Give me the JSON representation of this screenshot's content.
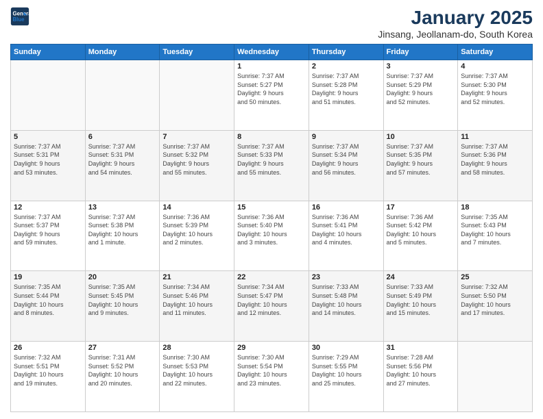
{
  "header": {
    "logo_line1": "General",
    "logo_line2": "Blue",
    "title": "January 2025",
    "subtitle": "Jinsang, Jeollanam-do, South Korea"
  },
  "weekdays": [
    "Sunday",
    "Monday",
    "Tuesday",
    "Wednesday",
    "Thursday",
    "Friday",
    "Saturday"
  ],
  "weeks": [
    [
      {
        "day": "",
        "info": ""
      },
      {
        "day": "",
        "info": ""
      },
      {
        "day": "",
        "info": ""
      },
      {
        "day": "1",
        "info": "Sunrise: 7:37 AM\nSunset: 5:27 PM\nDaylight: 9 hours\nand 50 minutes."
      },
      {
        "day": "2",
        "info": "Sunrise: 7:37 AM\nSunset: 5:28 PM\nDaylight: 9 hours\nand 51 minutes."
      },
      {
        "day": "3",
        "info": "Sunrise: 7:37 AM\nSunset: 5:29 PM\nDaylight: 9 hours\nand 52 minutes."
      },
      {
        "day": "4",
        "info": "Sunrise: 7:37 AM\nSunset: 5:30 PM\nDaylight: 9 hours\nand 52 minutes."
      }
    ],
    [
      {
        "day": "5",
        "info": "Sunrise: 7:37 AM\nSunset: 5:31 PM\nDaylight: 9 hours\nand 53 minutes."
      },
      {
        "day": "6",
        "info": "Sunrise: 7:37 AM\nSunset: 5:31 PM\nDaylight: 9 hours\nand 54 minutes."
      },
      {
        "day": "7",
        "info": "Sunrise: 7:37 AM\nSunset: 5:32 PM\nDaylight: 9 hours\nand 55 minutes."
      },
      {
        "day": "8",
        "info": "Sunrise: 7:37 AM\nSunset: 5:33 PM\nDaylight: 9 hours\nand 55 minutes."
      },
      {
        "day": "9",
        "info": "Sunrise: 7:37 AM\nSunset: 5:34 PM\nDaylight: 9 hours\nand 56 minutes."
      },
      {
        "day": "10",
        "info": "Sunrise: 7:37 AM\nSunset: 5:35 PM\nDaylight: 9 hours\nand 57 minutes."
      },
      {
        "day": "11",
        "info": "Sunrise: 7:37 AM\nSunset: 5:36 PM\nDaylight: 9 hours\nand 58 minutes."
      }
    ],
    [
      {
        "day": "12",
        "info": "Sunrise: 7:37 AM\nSunset: 5:37 PM\nDaylight: 9 hours\nand 59 minutes."
      },
      {
        "day": "13",
        "info": "Sunrise: 7:37 AM\nSunset: 5:38 PM\nDaylight: 10 hours\nand 1 minute."
      },
      {
        "day": "14",
        "info": "Sunrise: 7:36 AM\nSunset: 5:39 PM\nDaylight: 10 hours\nand 2 minutes."
      },
      {
        "day": "15",
        "info": "Sunrise: 7:36 AM\nSunset: 5:40 PM\nDaylight: 10 hours\nand 3 minutes."
      },
      {
        "day": "16",
        "info": "Sunrise: 7:36 AM\nSunset: 5:41 PM\nDaylight: 10 hours\nand 4 minutes."
      },
      {
        "day": "17",
        "info": "Sunrise: 7:36 AM\nSunset: 5:42 PM\nDaylight: 10 hours\nand 5 minutes."
      },
      {
        "day": "18",
        "info": "Sunrise: 7:35 AM\nSunset: 5:43 PM\nDaylight: 10 hours\nand 7 minutes."
      }
    ],
    [
      {
        "day": "19",
        "info": "Sunrise: 7:35 AM\nSunset: 5:44 PM\nDaylight: 10 hours\nand 8 minutes."
      },
      {
        "day": "20",
        "info": "Sunrise: 7:35 AM\nSunset: 5:45 PM\nDaylight: 10 hours\nand 9 minutes."
      },
      {
        "day": "21",
        "info": "Sunrise: 7:34 AM\nSunset: 5:46 PM\nDaylight: 10 hours\nand 11 minutes."
      },
      {
        "day": "22",
        "info": "Sunrise: 7:34 AM\nSunset: 5:47 PM\nDaylight: 10 hours\nand 12 minutes."
      },
      {
        "day": "23",
        "info": "Sunrise: 7:33 AM\nSunset: 5:48 PM\nDaylight: 10 hours\nand 14 minutes."
      },
      {
        "day": "24",
        "info": "Sunrise: 7:33 AM\nSunset: 5:49 PM\nDaylight: 10 hours\nand 15 minutes."
      },
      {
        "day": "25",
        "info": "Sunrise: 7:32 AM\nSunset: 5:50 PM\nDaylight: 10 hours\nand 17 minutes."
      }
    ],
    [
      {
        "day": "26",
        "info": "Sunrise: 7:32 AM\nSunset: 5:51 PM\nDaylight: 10 hours\nand 19 minutes."
      },
      {
        "day": "27",
        "info": "Sunrise: 7:31 AM\nSunset: 5:52 PM\nDaylight: 10 hours\nand 20 minutes."
      },
      {
        "day": "28",
        "info": "Sunrise: 7:30 AM\nSunset: 5:53 PM\nDaylight: 10 hours\nand 22 minutes."
      },
      {
        "day": "29",
        "info": "Sunrise: 7:30 AM\nSunset: 5:54 PM\nDaylight: 10 hours\nand 23 minutes."
      },
      {
        "day": "30",
        "info": "Sunrise: 7:29 AM\nSunset: 5:55 PM\nDaylight: 10 hours\nand 25 minutes."
      },
      {
        "day": "31",
        "info": "Sunrise: 7:28 AM\nSunset: 5:56 PM\nDaylight: 10 hours\nand 27 minutes."
      },
      {
        "day": "",
        "info": ""
      }
    ]
  ]
}
